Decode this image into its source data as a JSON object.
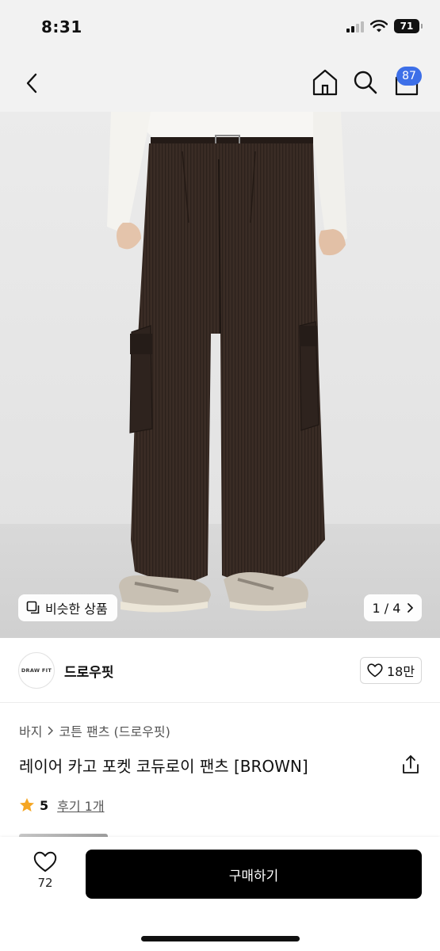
{
  "status_bar": {
    "time": "8:31",
    "battery": "71",
    "signal_icon": "cellular-signal-icon",
    "wifi_icon": "wifi-icon",
    "battery_icon": "battery-icon"
  },
  "nav": {
    "back_icon": "chevron-left-icon",
    "home_icon": "home-icon",
    "search_icon": "search-icon",
    "cart_icon": "shopping-bag-icon",
    "cart_count": "87",
    "badge_color": "#3d6fe8"
  },
  "gallery": {
    "similar_label": "비슷한 상품",
    "similar_icon": "copy-icon",
    "pager": "1 / 4",
    "current": 1,
    "total": 4
  },
  "brand": {
    "logo_text": "DRAW FIT",
    "name": "드로우핏",
    "like_count": "18만",
    "like_icon": "heart-outline-icon"
  },
  "product": {
    "breadcrumb": [
      "바지",
      "코튼 팬츠 (드로우핏)"
    ],
    "title": "레이어 카고 포켓 코듀로이 팬츠 [BROWN]",
    "share_icon": "share-icon",
    "rating": "5",
    "reviews_label": "후기 1개",
    "star_color": "#f5a623"
  },
  "bottom_bar": {
    "wish_count": "72",
    "wish_icon": "heart-outline-icon",
    "buy_label": "구매하기"
  }
}
